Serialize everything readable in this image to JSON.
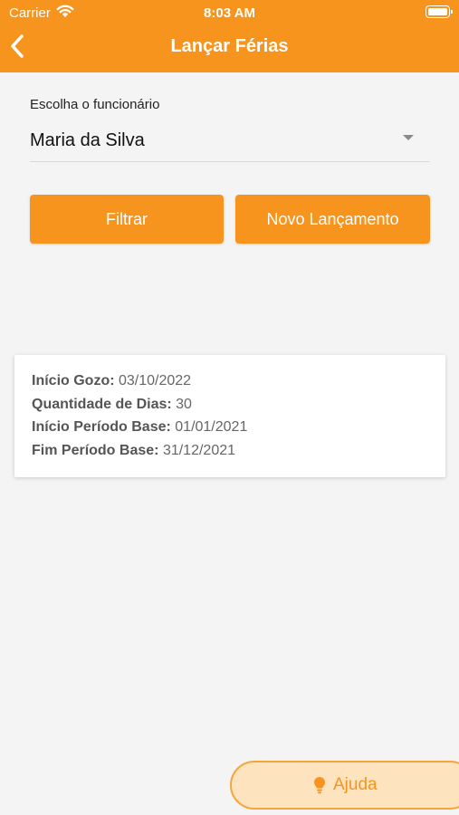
{
  "status_bar": {
    "carrier": "Carrier",
    "time": "8:03 AM"
  },
  "header": {
    "title": "Lançar Férias",
    "back_icon": "chevron-left-icon"
  },
  "form": {
    "employee_label": "Escolha o funcionário",
    "employee_value": "Maria da Silva"
  },
  "buttons": {
    "filter": "Filtrar",
    "new_entry": "Novo Lançamento"
  },
  "card": {
    "inicio_gozo_label": "Início Gozo:",
    "inicio_gozo_value": "03/10/2022",
    "quantidade_label": "Quantidade de Dias:",
    "quantidade_value": "30",
    "inicio_periodo_label": "Início Período Base:",
    "inicio_periodo_value": "01/01/2021",
    "fim_periodo_label": "Fim Período Base:",
    "fim_periodo_value": "31/12/2021"
  },
  "help": {
    "label": "Ajuda",
    "icon": "lightbulb-icon"
  },
  "colors": {
    "accent": "#f7941d",
    "background": "#f4f4f4",
    "help_bg": "#fde3be"
  }
}
